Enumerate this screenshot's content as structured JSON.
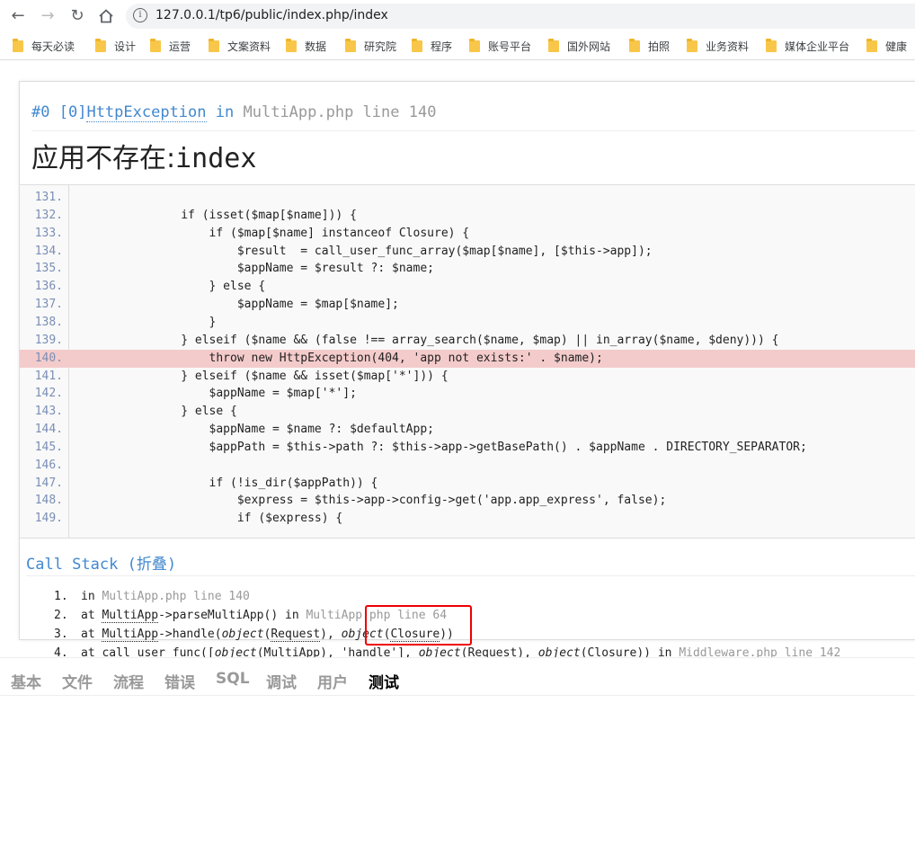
{
  "browser": {
    "url": "127.0.0.1/tp6/public/index.php/index",
    "bookmarks": [
      "每天必读",
      "设计",
      "运营",
      "文案资料",
      "数据",
      "研究院",
      "程序",
      "账号平台",
      "国外网站",
      "拍照",
      "业务资料",
      "媒体企业平台",
      "健康"
    ]
  },
  "exception": {
    "index": "#0",
    "code": "[0]",
    "class": "HttpException",
    "in_word": "in",
    "file": "MultiApp.php line 140",
    "message": "应用不存在:",
    "message_tail": "index"
  },
  "source": {
    "lines": [
      {
        "n": "131.",
        "code": ""
      },
      {
        "n": "132.",
        "code": "                if (isset($map[$name])) {"
      },
      {
        "n": "133.",
        "code": "                    if ($map[$name] instanceof Closure) {"
      },
      {
        "n": "134.",
        "code": "                        $result  = call_user_func_array($map[$name], [$this->app]);"
      },
      {
        "n": "135.",
        "code": "                        $appName = $result ?: $name;"
      },
      {
        "n": "136.",
        "code": "                    } else {"
      },
      {
        "n": "137.",
        "code": "                        $appName = $map[$name];"
      },
      {
        "n": "138.",
        "code": "                    }"
      },
      {
        "n": "139.",
        "code": "                } elseif ($name && (false !== array_search($name, $map) || in_array($name, $deny))) {"
      },
      {
        "n": "140.",
        "code": "                    throw new HttpException(404, 'app not exists:' . $name);"
      },
      {
        "n": "141.",
        "code": "                } elseif ($name && isset($map['*'])) {"
      },
      {
        "n": "142.",
        "code": "                    $appName = $map['*'];"
      },
      {
        "n": "143.",
        "code": "                } else {"
      },
      {
        "n": "144.",
        "code": "                    $appName = $name ?: $defaultApp;"
      },
      {
        "n": "145.",
        "code": "                    $appPath = $this->path ?: $this->app->getBasePath() . $appName . DIRECTORY_SEPARATOR;"
      },
      {
        "n": "146.",
        "code": ""
      },
      {
        "n": "147.",
        "code": "                    if (!is_dir($appPath)) {"
      },
      {
        "n": "148.",
        "code": "                        $express = $this->app->config->get('app.app_express', false);"
      },
      {
        "n": "149.",
        "code": "                        if ($express) {"
      }
    ],
    "highlight_line": "140."
  },
  "call_stack": {
    "title": "Call Stack (折叠)",
    "items": [
      {
        "num": "1.",
        "parts": [
          [
            "",
            "in "
          ],
          [
            "gray",
            "MultiApp.php line 140"
          ]
        ]
      },
      {
        "num": "2.",
        "parts": [
          [
            "",
            "at "
          ],
          [
            "abbr",
            "MultiApp"
          ],
          [
            "",
            "->parseMultiApp() in "
          ],
          [
            "gray",
            "MultiApp.php line 64"
          ]
        ]
      },
      {
        "num": "3.",
        "parts": [
          [
            "",
            "at "
          ],
          [
            "abbr",
            "MultiApp"
          ],
          [
            "",
            "->handle("
          ],
          [
            "i",
            "object"
          ],
          [
            "",
            "("
          ],
          [
            "abbr",
            "Request"
          ],
          [
            "",
            "), "
          ],
          [
            "i",
            "object"
          ],
          [
            "",
            "("
          ],
          [
            "abbr",
            "Closure"
          ],
          [
            "",
            "))"
          ]
        ]
      },
      {
        "num": "4.",
        "parts": [
          [
            "",
            "at call_user_func(["
          ],
          [
            "i",
            "object"
          ],
          [
            "",
            "(MultiApp), 'handle'], "
          ],
          [
            "i",
            "object"
          ],
          [
            "",
            "(Request), "
          ],
          [
            "i",
            "object"
          ],
          [
            "",
            "(Closure)) in "
          ],
          [
            "gray",
            "Middleware.php line 142"
          ]
        ]
      }
    ]
  },
  "trace_tabs": [
    "基本",
    "文件",
    "流程",
    "错误",
    "SQL",
    "调试",
    "用户",
    "测试"
  ],
  "active_tab": "测试",
  "colors": {
    "link": "#4288ce",
    "highlight": "#f4cbcb",
    "annotation": "#ee0000"
  }
}
